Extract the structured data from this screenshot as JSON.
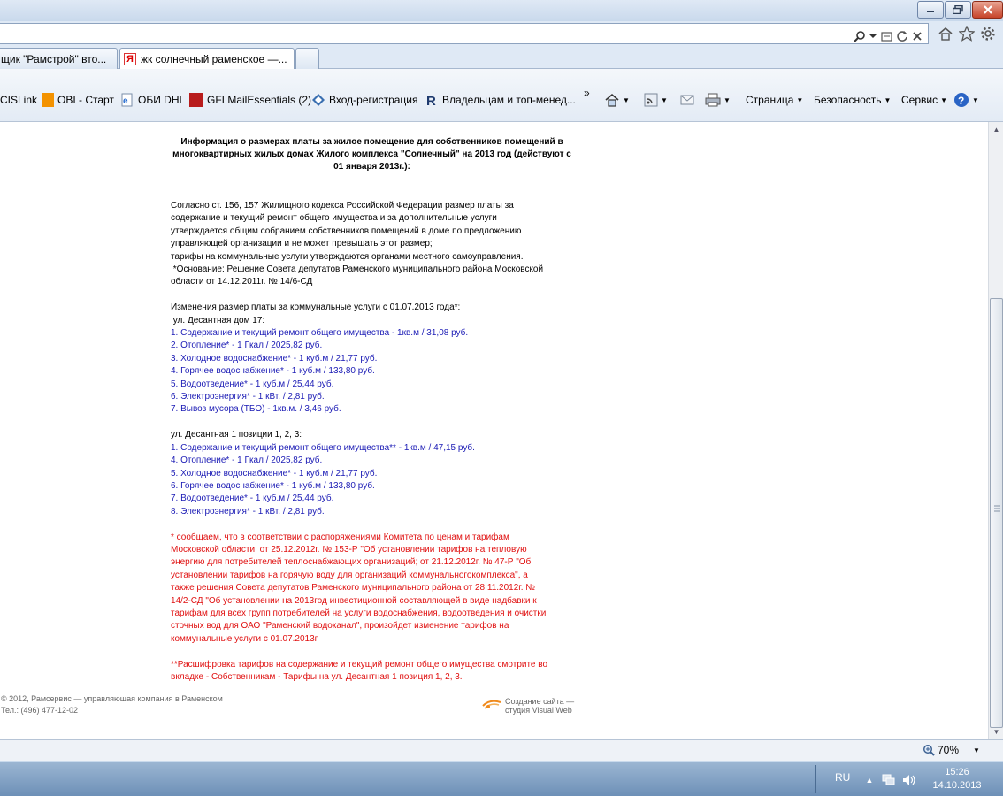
{
  "tabs": [
    {
      "label": "щик \"Рамстрой\" вто..."
    },
    {
      "label": "жк солнечный раменское —...",
      "favicon": "Я"
    }
  ],
  "favorites": [
    {
      "label": "CISLink"
    },
    {
      "label": "OBI - Старт"
    },
    {
      "label": "ОБИ DHL"
    },
    {
      "label": "GFI MailEssentials (2)"
    },
    {
      "label": "Вход-регистрация"
    },
    {
      "label": "Владельцам и топ-менед..."
    }
  ],
  "commands": {
    "page": "Страница",
    "safety": "Безопасность",
    "service": "Сервис"
  },
  "article": {
    "title": "Информация о размерах платы за жилое помещение для собственников помещений в многоквартирных жилых домах Жилого комплекса \"Солнечный\" на 2013 год (действуют с 01 января 2013г.):",
    "intro": [
      "Согласно ст. 156, 157 Жилищного кодекса Российской Федерации размер платы за",
      "содержание и текущий ремонт общего имущества и за дополнительные услуги",
      "утверждается общим собранием собственников помещений в доме по предложению",
      "управляющей организации и не может превышать этот размер;",
      "тарифы на коммунальные услуги утверждаются органами местного самоуправления.",
      " *Основание: Решение Совета депутатов Раменского муниципального района Московской",
      "области от 14.12.2011г. № 14/6-СД"
    ],
    "changes_heading": "Изменения размер платы за коммунальные услуги с 01.07.2013 года*:",
    "section1_heading": " ул. Десантная дом 17:",
    "section1_items": [
      "1. Содержание и текущий ремонт общего имущества - 1кв.м / 31,08 руб.",
      "2. Отопление* - 1 Гкал / 2025,82 руб.",
      "3. Холодное водоснабжение* - 1 куб.м / 21,77 руб.",
      "4. Горячее водоснабжение* - 1 куб.м / 133,80 руб.",
      "5. Водоотведение* - 1 куб.м / 25,44 руб.",
      "6. Электроэнергия* - 1 кВт. / 2,81 руб.",
      "7. Вывоз мусора (ТБО) - 1кв.м. / 3,46 руб."
    ],
    "section2_heading": "ул. Десантная 1 позиции 1, 2, 3:",
    "section2_items": [
      "1. Содержание и текущий ремонт общего имущества** - 1кв.м / 47,15 руб.",
      "4. Отопление* - 1 Гкал / 2025,82 руб.",
      "5. Холодное водоснабжение* - 1 куб.м / 21,77 руб.",
      "6. Горячее водоснабжение* - 1 куб.м / 133,80 руб.",
      "7. Водоотведение* - 1 куб.м / 25,44 руб.",
      "8. Электроэнергия* - 1 кВт. / 2,81 руб."
    ],
    "note1": [
      "* сообщаем, что в соответствии с распоряжениями Комитета по ценам и тарифам",
      "Московской области: от 25.12.2012г. № 153-Р \"Об установлении тарифов на тепловую",
      "энергию для потребителей теплоснабжающих организаций; от 21.12.2012г. № 47-Р \"Об",
      "установлении тарифов на горячую воду для организаций коммунальногокомплекса\", а",
      "также решения Совета депутатов Раменского муниципального района от 28.11.2012г. №",
      "14/2-СД \"Об установлении на 2013год инвестиционной составляющей в виде надбавки к",
      "тарифам для всех групп потребителей на услуги водоснабжения, водоотведения и очистки",
      "сточных вод для ОАО \"Раменский водоканал\", произойдет изменение тарифов на",
      "коммунальные услуги с 01.07.2013г."
    ],
    "note2": [
      "**Расшифровка тарифов на содержание и текущий ремонт общего имущества смотрите во",
      "вкладке - Собственникам - Тарифы на ул. Десантная 1 позиция 1, 2, 3."
    ]
  },
  "footer": {
    "copyright": "© 2012, Рамсервис — управляющая компания в Раменском",
    "phone": "Тел.: (496) 477-12-02",
    "credit_line1": "Создание сайта —",
    "credit_line2": "студия Visual Web"
  },
  "status": {
    "zoom": "70%"
  },
  "taskbar": {
    "language": "RU",
    "time": "15:26",
    "date": "14.10.2013"
  }
}
